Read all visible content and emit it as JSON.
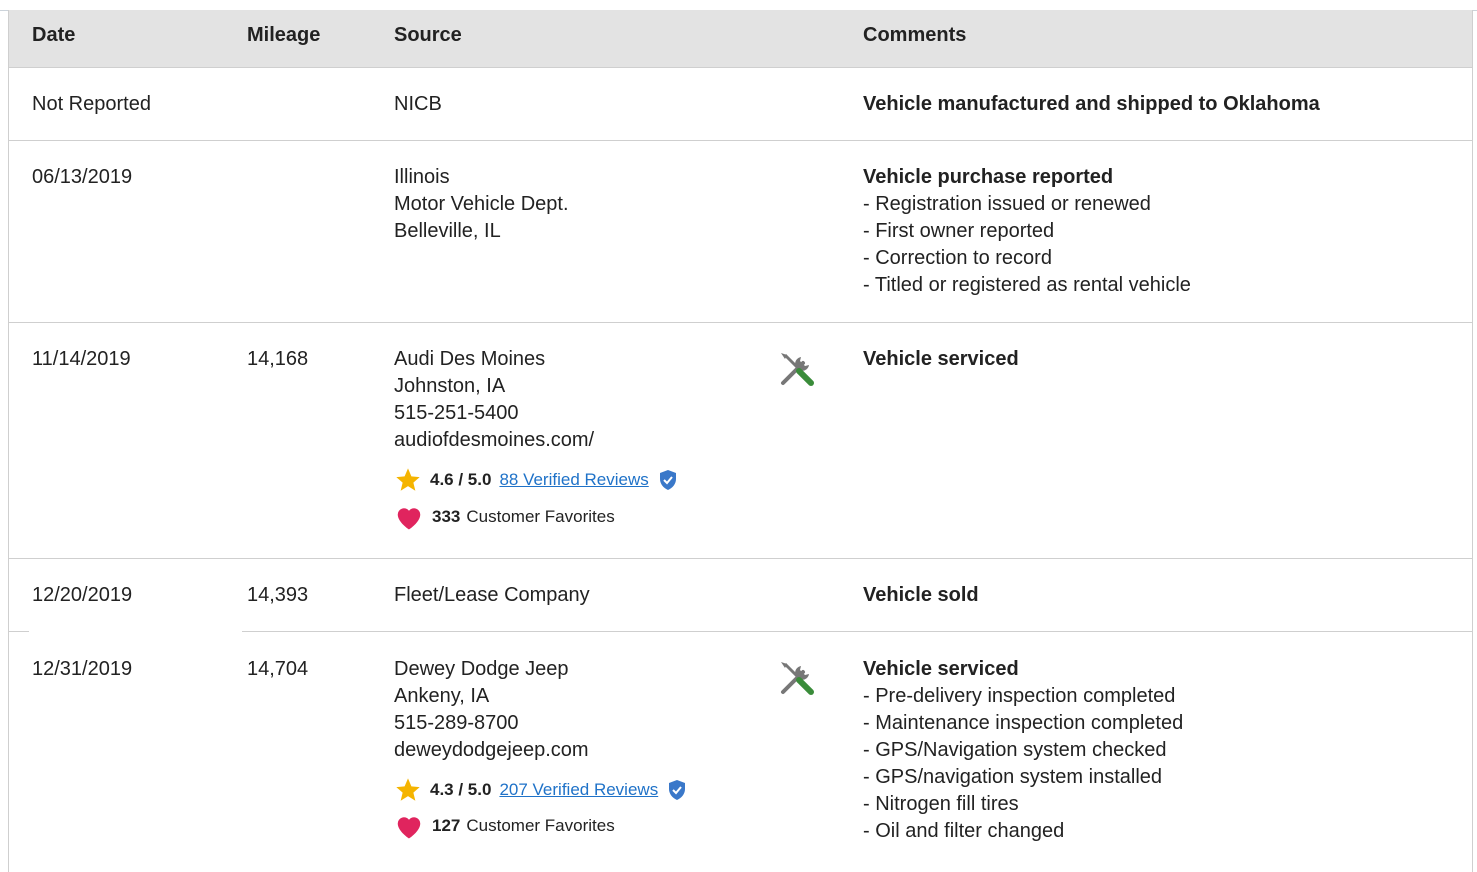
{
  "headers": {
    "date": "Date",
    "mileage": "Mileage",
    "source": "Source",
    "comments": "Comments"
  },
  "rows": [
    {
      "date": "Not Reported",
      "mileage": "",
      "source": [
        "NICB"
      ],
      "comment_title": "Vehicle manufactured and shipped to Oklahoma",
      "comment_items": []
    },
    {
      "date": "06/13/2019",
      "mileage": "",
      "source": [
        "Illinois",
        "Motor Vehicle Dept.",
        "Belleville, IL"
      ],
      "comment_title": "Vehicle purchase reported",
      "comment_items": [
        "Registration issued or renewed",
        "First owner reported",
        "Correction to record",
        "Titled or registered as rental vehicle"
      ]
    },
    {
      "date": "11/14/2019",
      "mileage": "14,168",
      "source": [
        "Audi Des Moines",
        "Johnston, IA",
        "515-251-5400",
        "audiofdesmoines.com/"
      ],
      "rating": "4.6 / 5.0",
      "reviews": "88 Verified Reviews",
      "favorites_count": "333",
      "favorites_label": "Customer Favorites",
      "comment_title": "Vehicle serviced",
      "comment_items": []
    },
    {
      "date": "12/20/2019",
      "mileage": "14,393",
      "source": [
        "Fleet/Lease Company"
      ],
      "comment_title": "Vehicle sold",
      "comment_items": []
    },
    {
      "date": "12/31/2019",
      "mileage": "14,704",
      "source": [
        "Dewey Dodge Jeep",
        "Ankeny, IA",
        "515-289-8700",
        "deweydodgejeep.com"
      ],
      "rating": "4.3 / 5.0",
      "reviews": "207 Verified Reviews",
      "favorites_count": "127",
      "favorites_label": "Customer Favorites",
      "comment_title": "Vehicle serviced",
      "comment_items": [
        "Pre-delivery inspection completed",
        "Maintenance inspection completed",
        "GPS/Navigation system checked",
        "GPS/navigation system installed",
        "Nitrogen fill tires",
        "Oil and filter changed"
      ]
    }
  ],
  "icons": {
    "service": "wrench-screwdriver-icon",
    "star": "star-icon",
    "heart": "heart-icon",
    "shield": "verified-shield-icon"
  },
  "colors": {
    "header_bg": "#e3e3e3",
    "link": "#1f72c8",
    "star": "#f5b400",
    "heart": "#e0245e",
    "shield": "#3a78c9",
    "tool_green": "#3a8c3a",
    "tool_gray": "#777777"
  }
}
